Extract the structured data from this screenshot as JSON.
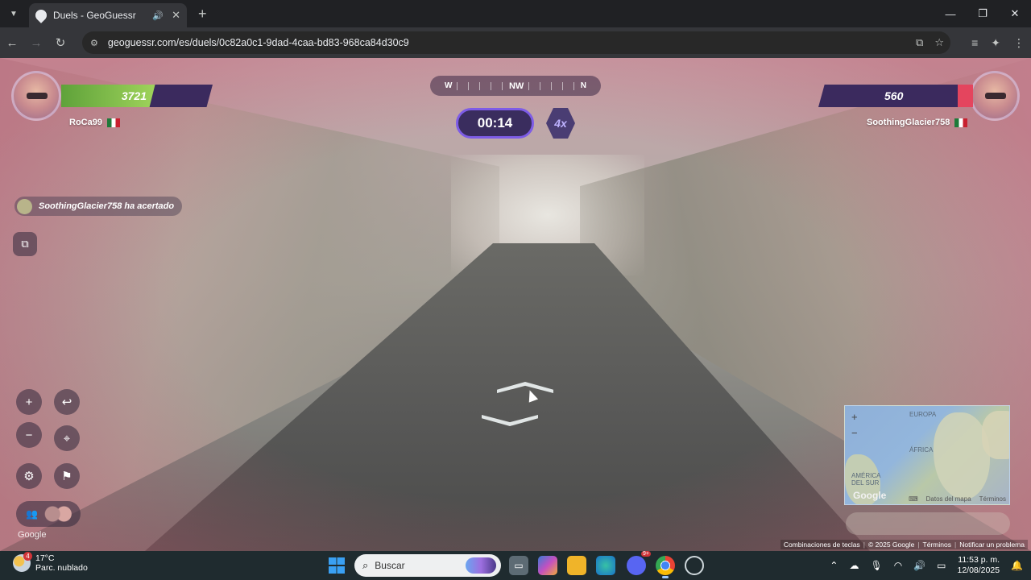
{
  "browser": {
    "tab_title": "Duels - GeoGuessr",
    "url": "geoguessr.com/es/duels/0c82a0c1-9dad-4caa-bd83-968ca84d30c9"
  },
  "game": {
    "compass": {
      "left": "W",
      "center": "NW",
      "right": "N"
    },
    "timer": "00:14",
    "multiplier": "4x",
    "player_left": {
      "name": "RoCa99",
      "score": "3721",
      "health_fraction": 0.62
    },
    "player_right": {
      "name": "SoothingGlacier758",
      "score": "560",
      "health_fraction": 0.1
    },
    "notification": "SoothingGlacier758 ha acertado",
    "google_watermark": "Google",
    "minimap": {
      "labels": {
        "europe": "EUROPA",
        "africa": "ÁFRICA",
        "south_america": "AMÉRICA DEL SUR"
      },
      "google": "Google",
      "map_data": "Datos del mapa",
      "terms": "Términos"
    },
    "attribution": [
      "Combinaciones de teclas",
      "© 2025 Google",
      "Términos",
      "Notificar un problema"
    ]
  },
  "taskbar": {
    "weather_temp": "17°C",
    "weather_desc": "Parc. nublado",
    "weather_badge": "4",
    "search_placeholder": "Buscar",
    "time": "11:53 p. m.",
    "date": "12/08/2025",
    "discord_badge": "9+"
  },
  "colors": {
    "timer_border": "#7d5ce6",
    "health_green": "#9fd35b",
    "health_red": "#e4455e",
    "panel_purple": "#3b2a5e"
  }
}
